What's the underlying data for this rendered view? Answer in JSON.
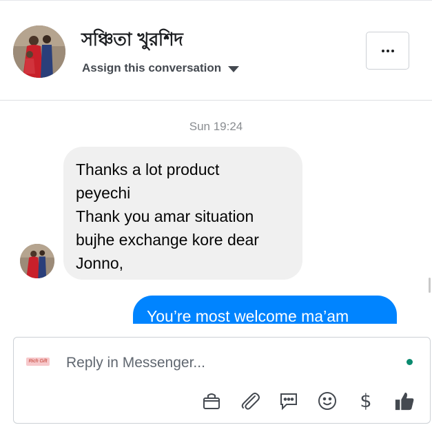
{
  "header": {
    "contact_name": "সঞ্চিতা খুরশিদ",
    "assign_label": "Assign this conversation"
  },
  "thread": {
    "timestamp": "Sun 19:24",
    "incoming_message": {
      "lines": [
        "Thanks a lot product",
        "peyechi",
        "Thank you amar situation",
        "bujhe exchange kore dear",
        "Jonno,"
      ]
    },
    "outgoing_message": {
      "text": "You’re most welcome ma’am"
    }
  },
  "composer": {
    "placeholder": "Reply in Messenger...",
    "page_badge_text": "Rich Gift",
    "online_status_color": "#0a8a6f",
    "tool_icons": [
      "shop-bag-icon",
      "attachment-icon",
      "saved-reply-icon",
      "emoji-icon",
      "dollar-icon",
      "thumbs-up-icon"
    ]
  },
  "colors": {
    "outgoing_bubble": "#0084ff",
    "incoming_bubble": "#f0f0f0"
  }
}
